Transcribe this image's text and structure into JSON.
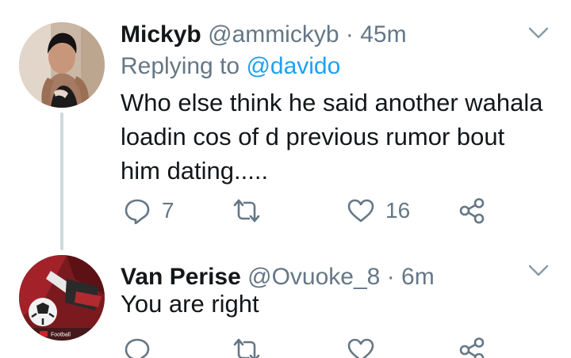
{
  "colors": {
    "text": "#14171a",
    "secondary": "#657786",
    "link": "#1da1f2",
    "thread_line": "#cfd9de"
  },
  "tweets": [
    {
      "display_name": "Mickyb",
      "handle": "@ammickyb",
      "separator": "·",
      "time": "45m",
      "replying_prefix": "Replying to",
      "replying_to": "@davido",
      "text": "Who else think he said another wahala loadin cos of d previous rumor bout him dating.....",
      "reply_count": "7",
      "retweet_count": "",
      "like_count": "16",
      "icons": {
        "reply": "reply-icon",
        "retweet": "retweet-icon",
        "like": "heart-icon",
        "share": "share-icon",
        "menu": "chevron-down-icon"
      }
    },
    {
      "display_name": "Van Perise",
      "handle": "@Ovuoke_8",
      "separator": "·",
      "time": "6m",
      "text": "You are right",
      "reply_count": "",
      "retweet_count": "",
      "like_count": "",
      "avatar_watermark": "Football",
      "icons": {
        "reply": "reply-icon",
        "retweet": "retweet-icon",
        "like": "heart-icon",
        "share": "share-icon",
        "menu": "chevron-down-icon"
      }
    }
  ]
}
